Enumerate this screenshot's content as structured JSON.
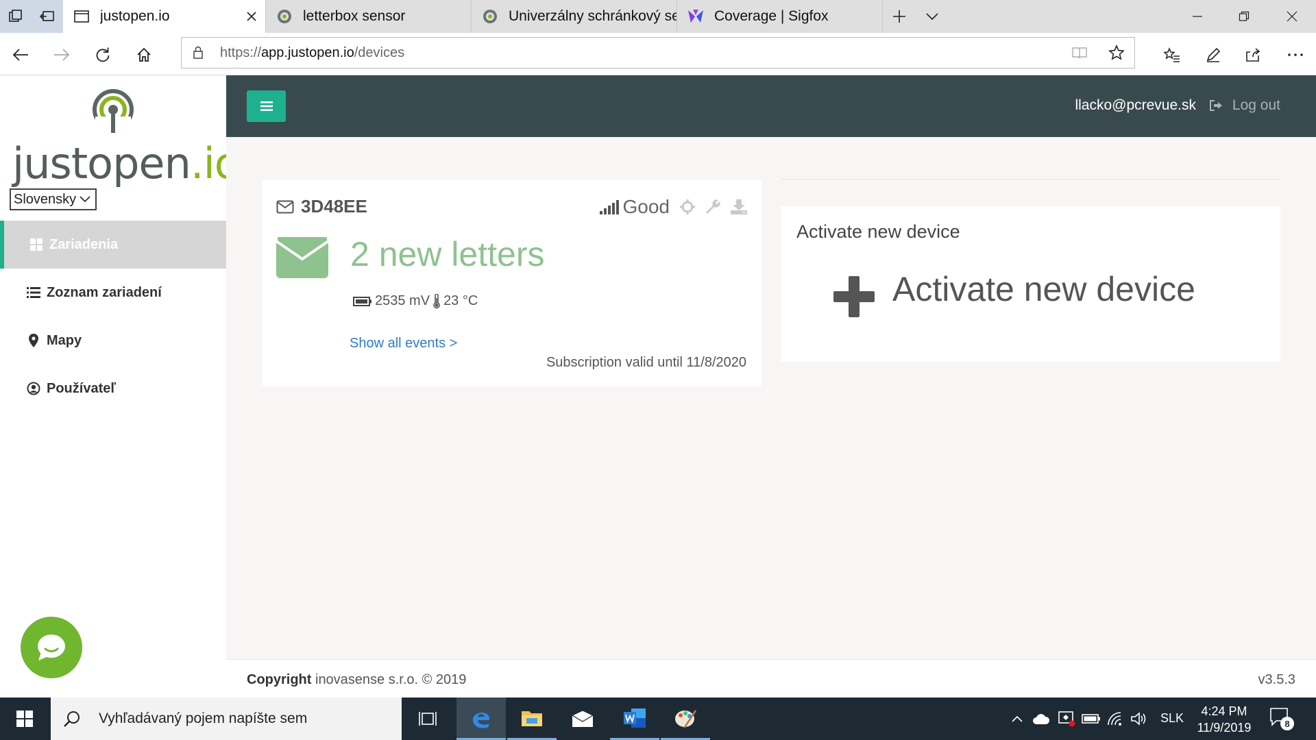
{
  "browser": {
    "tabs": [
      {
        "title": "justopen.io",
        "icon": "page-icon",
        "active": true
      },
      {
        "title": "letterbox sensor",
        "icon": "justopen-favicon"
      },
      {
        "title": "Univerzálny schránkový sen",
        "icon": "justopen-favicon"
      },
      {
        "title": "Coverage | Sigfox",
        "icon": "sigfox-favicon"
      }
    ],
    "url_scheme": "https://",
    "url_host": "app.justopen.io",
    "url_path": "/devices"
  },
  "app": {
    "logo_text_main": "justopen",
    "logo_text_suffix": ".io",
    "language": "Slovensky",
    "sidebar": [
      {
        "label": "Zariadenia",
        "icon": "grid-icon",
        "active": true
      },
      {
        "label": "Zoznam zariadení",
        "icon": "list-icon"
      },
      {
        "label": "Mapy",
        "icon": "map-pin-icon"
      },
      {
        "label": "Používateľ",
        "icon": "user-circle-icon"
      }
    ],
    "header": {
      "user_email": "llacko@pcrevue.sk",
      "logout_label": "Log out"
    },
    "device_card": {
      "device_id": "3D48EE",
      "signal_label": "Good",
      "new_letters": "2 new letters",
      "voltage": "2535 mV",
      "temperature": "23 °C",
      "events_link": "Show all events >",
      "subscription": "Subscription valid until 11/8/2020"
    },
    "activate_card": {
      "title": "Activate new device",
      "action_label": "Activate new device"
    },
    "footer": {
      "copyright_bold": "Copyright",
      "copyright_rest": " inovasense s.r.o. © 2019",
      "version": "v3.5.3"
    }
  },
  "taskbar": {
    "search_placeholder": "Vyhľadávaný pojem napíšte sem",
    "language": "SLK",
    "time": "4:24 PM",
    "date": "11/9/2019",
    "notification_count": "8"
  },
  "colors": {
    "accent_teal": "#1eb18f",
    "header_dark": "#394a4f",
    "letters_green": "#8ec28f",
    "logo_green": "#8ab51e",
    "link_blue": "#2f7bc4"
  }
}
